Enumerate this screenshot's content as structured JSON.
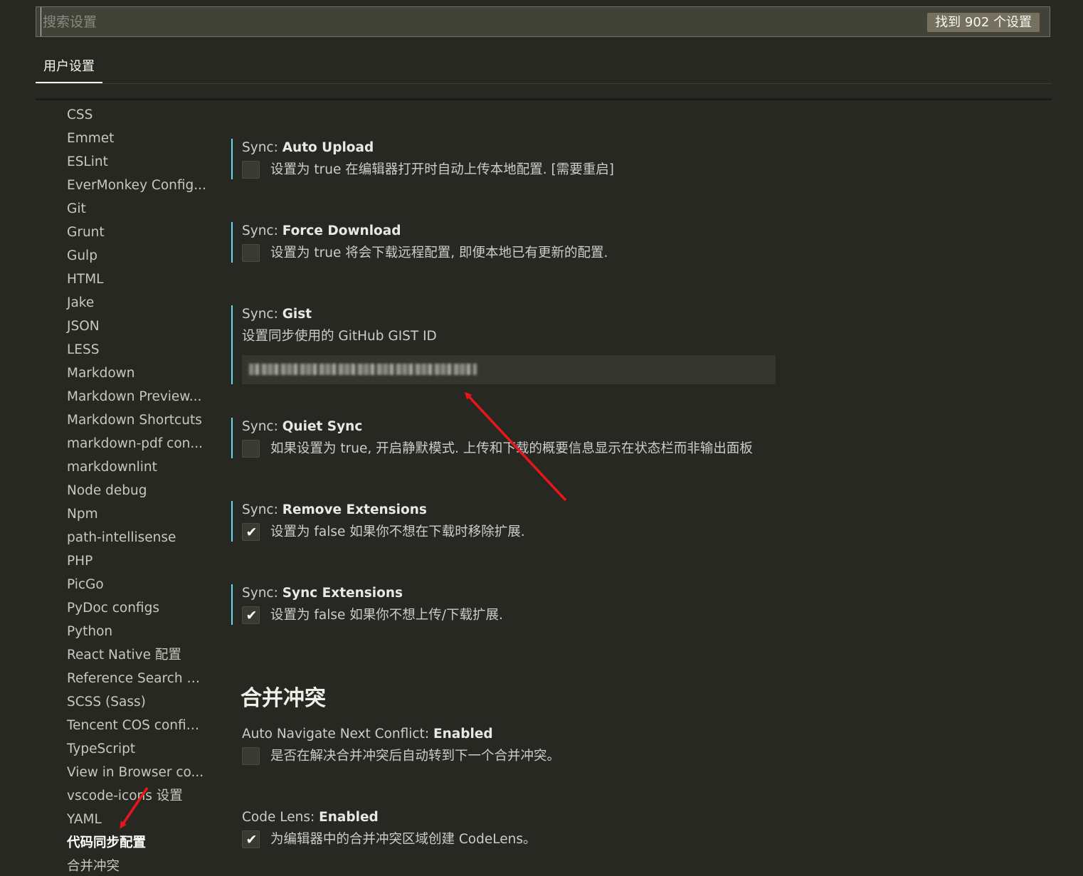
{
  "search": {
    "placeholder": "搜索设置",
    "result_count": "找到 902 个设置"
  },
  "tabs": [
    {
      "label": "用户设置"
    }
  ],
  "toc": {
    "items": [
      "CSS",
      "Emmet",
      "ESLint",
      "EverMonkey Config...",
      "Git",
      "Grunt",
      "Gulp",
      "HTML",
      "Jake",
      "JSON",
      "LESS",
      "Markdown",
      "Markdown Preview...",
      "Markdown Shortcuts",
      "markdown-pdf con...",
      "markdownlint",
      "Node debug",
      "Npm",
      "path-intellisense",
      "PHP",
      "PicGo",
      "PyDoc configs",
      "Python",
      "React Native 配置",
      "Reference Search V...",
      "SCSS (Sass)",
      "Tencent COS config...",
      "TypeScript",
      "View in Browser co...",
      "vscode-icons 设置",
      "YAML",
      "代码同步配置",
      "合并冲突"
    ],
    "active_index": 31
  },
  "settings": [
    {
      "category": "Sync: ",
      "name": "Auto Upload",
      "type": "checkbox",
      "checked": false,
      "description": "设置为 true 在编辑器打开时自动上传本地配置. [需要重启]"
    },
    {
      "category": "Sync: ",
      "name": "Force Download",
      "type": "checkbox",
      "checked": false,
      "description": "设置为 true 将会下载远程配置, 即便本地已有更新的配置."
    },
    {
      "category": "Sync: ",
      "name": "Gist",
      "type": "text",
      "description": "设置同步使用的 GitHub GIST ID"
    },
    {
      "category": "Sync: ",
      "name": "Quiet Sync",
      "type": "checkbox",
      "checked": false,
      "description": "如果设置为 true, 开启静默模式. 上传和下载的概要信息显示在状态栏而非输出面板"
    },
    {
      "category": "Sync: ",
      "name": "Remove Extensions",
      "type": "checkbox",
      "checked": true,
      "description": "设置为 false 如果你不想在下载时移除扩展."
    },
    {
      "category": "Sync: ",
      "name": "Sync Extensions",
      "type": "checkbox",
      "checked": true,
      "description": "设置为 false 如果你不想上传/下载扩展."
    }
  ],
  "merge_section": {
    "heading": "合并冲突",
    "settings": [
      {
        "category": "Auto Navigate Next Conflict: ",
        "name": "Enabled",
        "type": "checkbox",
        "checked": false,
        "description": "是否在解决合并冲突后自动转到下一个合并冲突。"
      },
      {
        "category": "Code Lens: ",
        "name": "Enabled",
        "type": "checkbox",
        "checked": true,
        "description": "为编辑器中的合并冲突区域创建 CodeLens。"
      }
    ]
  },
  "colors": {
    "background": "#272822",
    "modified_indicator": "#66d9ef",
    "annotation_arrow": "#e8151b"
  }
}
